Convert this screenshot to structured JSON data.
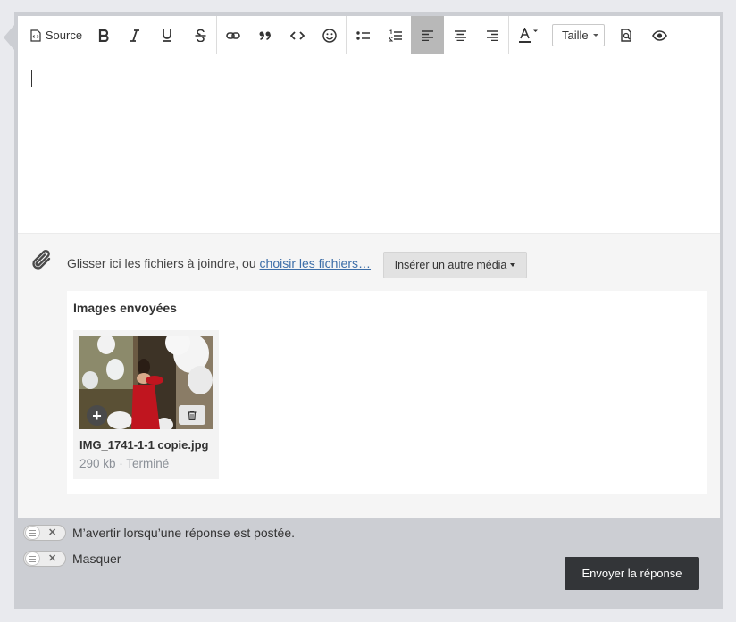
{
  "toolbar": {
    "source_label": "Source",
    "size_label": "Taille",
    "icons": [
      "source-icon",
      "bold-icon",
      "italic-icon",
      "underline-icon",
      "strikethrough-icon",
      "link-icon",
      "quote-icon",
      "code-icon",
      "emoji-icon",
      "bullet-list-icon",
      "numbered-list-icon",
      "align-left-icon",
      "align-center-icon",
      "align-right-icon",
      "text-color-icon",
      "preview-icon",
      "eye-icon"
    ],
    "active_button": "align-left"
  },
  "attachments": {
    "drop_text": "Glisser ici les fichiers à joindre, ou ",
    "choose_link": "choisir les fichiers…",
    "insert_media_label": "Insérer un autre média",
    "uploaded_title": "Images envoyées",
    "files": [
      {
        "name": "IMG_1741-1-1 copie.jpg",
        "meta": "290 kb · Terminé"
      }
    ]
  },
  "options": {
    "notify_label": "M’avertir lorsqu’une réponse est postée.",
    "hide_label": "Masquer",
    "toggle_off_symbol": "✕"
  },
  "actions": {
    "send_label": "Envoyer la réponse"
  },
  "colors": {
    "link": "#3d6ea8",
    "send_button": "#333538",
    "active_toolbar": "#b8b8b8"
  }
}
